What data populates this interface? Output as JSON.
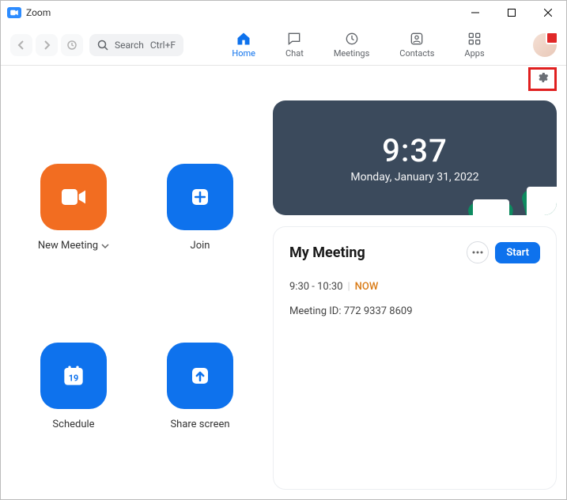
{
  "window": {
    "title": "Zoom"
  },
  "toolbar": {
    "search_label": "Search",
    "search_shortcut": "Ctrl+F"
  },
  "tabs": {
    "home": "Home",
    "chat": "Chat",
    "meetings": "Meetings",
    "contacts": "Contacts",
    "apps": "Apps"
  },
  "actions": {
    "new_meeting": "New Meeting",
    "join": "Join",
    "schedule": "Schedule",
    "schedule_day": "19",
    "share_screen": "Share screen"
  },
  "clock": {
    "time": "9:37",
    "date": "Monday, January 31, 2022"
  },
  "meeting": {
    "title": "My Meeting",
    "start_label": "Start",
    "time_range": "9:30 - 10:30",
    "now_label": "NOW",
    "id_label": "Meeting ID: 772 9337 8609"
  }
}
